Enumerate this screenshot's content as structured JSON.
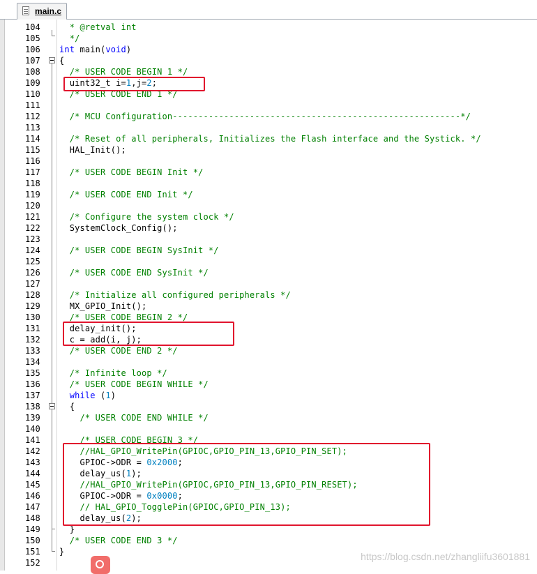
{
  "tab": {
    "title": "main.c"
  },
  "lines": [
    {
      "n": "104",
      "t": "  * @retval int"
    },
    {
      "n": "105",
      "t": "  */"
    },
    {
      "n": "106",
      "t": "int main(void)"
    },
    {
      "n": "107",
      "t": "{"
    },
    {
      "n": "108",
      "t": "  /* USER CODE BEGIN 1 */"
    },
    {
      "n": "109",
      "t": "  uint32_t i=1,j=2;"
    },
    {
      "n": "110",
      "t": "  /* USER CODE END 1 */"
    },
    {
      "n": "111",
      "t": ""
    },
    {
      "n": "112",
      "t": "  /* MCU Configuration--------------------------------------------------------*/"
    },
    {
      "n": "113",
      "t": ""
    },
    {
      "n": "114",
      "t": "  /* Reset of all peripherals, Initializes the Flash interface and the Systick. */"
    },
    {
      "n": "115",
      "t": "  HAL_Init();"
    },
    {
      "n": "116",
      "t": ""
    },
    {
      "n": "117",
      "t": "  /* USER CODE BEGIN Init */"
    },
    {
      "n": "118",
      "t": ""
    },
    {
      "n": "119",
      "t": "  /* USER CODE END Init */"
    },
    {
      "n": "120",
      "t": ""
    },
    {
      "n": "121",
      "t": "  /* Configure the system clock */"
    },
    {
      "n": "122",
      "t": "  SystemClock_Config();"
    },
    {
      "n": "123",
      "t": ""
    },
    {
      "n": "124",
      "t": "  /* USER CODE BEGIN SysInit */"
    },
    {
      "n": "125",
      "t": ""
    },
    {
      "n": "126",
      "t": "  /* USER CODE END SysInit */"
    },
    {
      "n": "127",
      "t": ""
    },
    {
      "n": "128",
      "t": "  /* Initialize all configured peripherals */"
    },
    {
      "n": "129",
      "t": "  MX_GPIO_Init();"
    },
    {
      "n": "130",
      "t": "  /* USER CODE BEGIN 2 */"
    },
    {
      "n": "131",
      "t": "  delay_init();"
    },
    {
      "n": "132",
      "t": "  c = add(i, j);"
    },
    {
      "n": "133",
      "t": "  /* USER CODE END 2 */"
    },
    {
      "n": "134",
      "t": ""
    },
    {
      "n": "135",
      "t": "  /* Infinite loop */"
    },
    {
      "n": "136",
      "t": "  /* USER CODE BEGIN WHILE */"
    },
    {
      "n": "137",
      "t": "  while (1)"
    },
    {
      "n": "138",
      "t": "  {"
    },
    {
      "n": "139",
      "t": "    /* USER CODE END WHILE */"
    },
    {
      "n": "140",
      "t": ""
    },
    {
      "n": "141",
      "t": "    /* USER CODE BEGIN 3 */"
    },
    {
      "n": "142",
      "t": "    //HAL_GPIO_WritePin(GPIOC,GPIO_PIN_13,GPIO_PIN_SET);"
    },
    {
      "n": "143",
      "t": "    GPIOC->ODR = 0x2000;"
    },
    {
      "n": "144",
      "t": "    delay_us(1);"
    },
    {
      "n": "145",
      "t": "    //HAL_GPIO_WritePin(GPIOC,GPIO_PIN_13,GPIO_PIN_RESET);"
    },
    {
      "n": "146",
      "t": "    GPIOC->ODR = 0x0000;"
    },
    {
      "n": "147",
      "t": "    // HAL_GPIO_TogglePin(GPIOC,GPIO_PIN_13);"
    },
    {
      "n": "148",
      "t": "    delay_us(2);"
    },
    {
      "n": "149",
      "t": "  }"
    },
    {
      "n": "150",
      "t": "  /* USER CODE END 3 */"
    },
    {
      "n": "151",
      "t": "}"
    },
    {
      "n": "152",
      "t": ""
    }
  ],
  "watermark": "https://blog.csdn.net/zhangliifu3601881",
  "colors": {
    "keyword": "#0000ff",
    "comment": "#008000",
    "number": "#0080c0",
    "highlight": "#e1142d"
  }
}
